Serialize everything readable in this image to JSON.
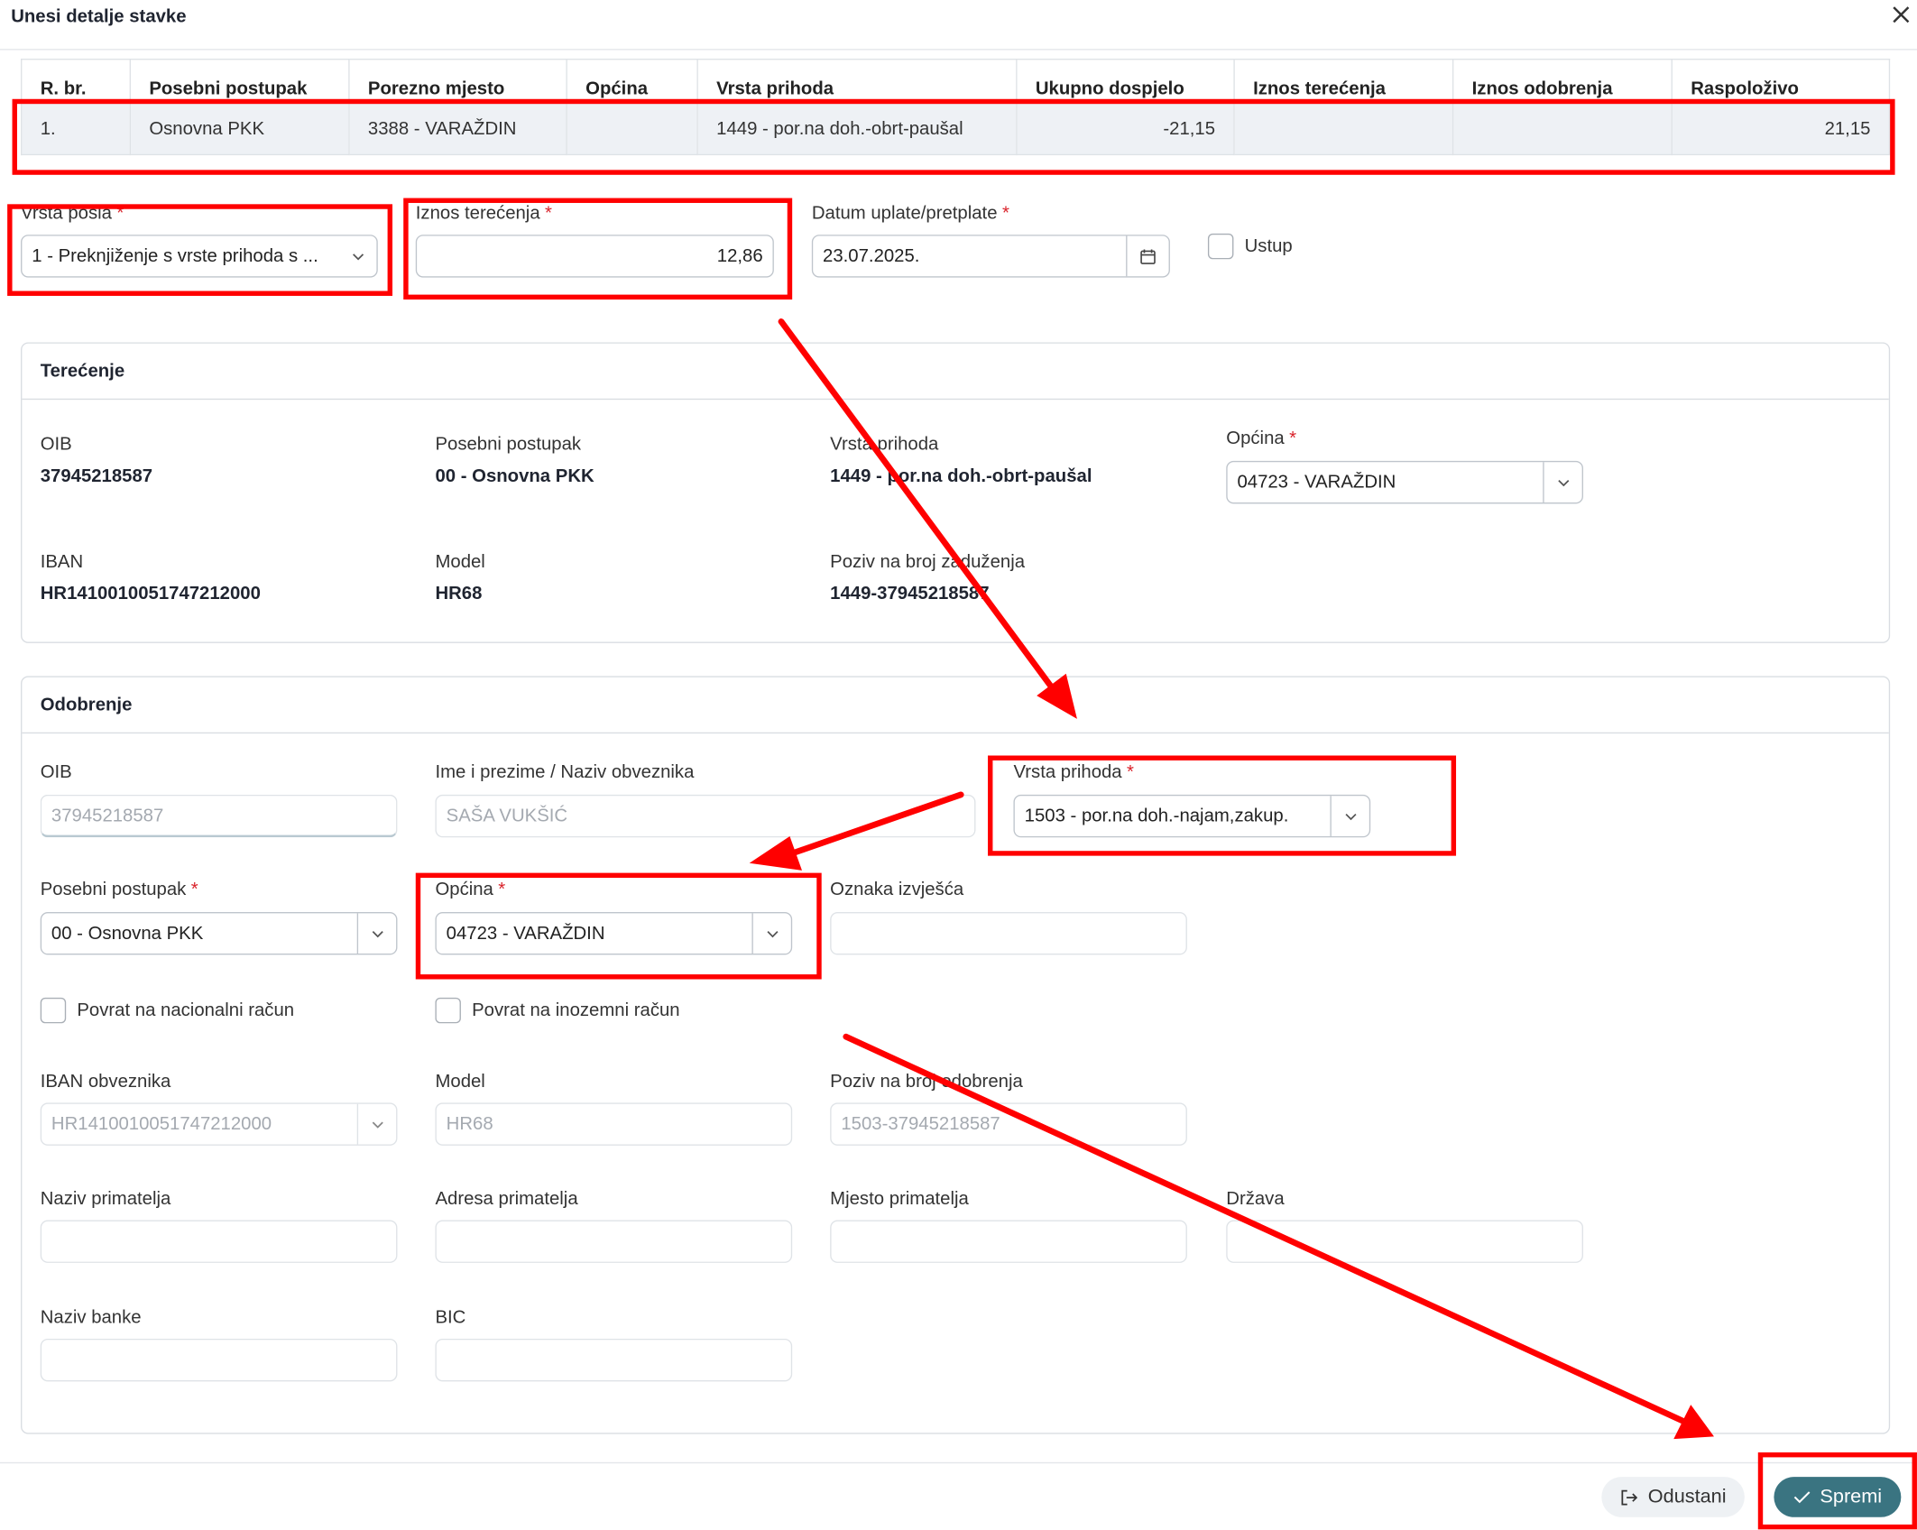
{
  "dialog": {
    "title": "Unesi detalje stavke"
  },
  "table": {
    "headers": [
      "R. br.",
      "Posebni postupak",
      "Porezno mjesto",
      "Općina",
      "Vrsta prihoda",
      "Ukupno dospjelo",
      "Iznos terećenja",
      "Iznos odobrenja",
      "Raspoloživo"
    ],
    "rows": [
      [
        "1.",
        "Osnovna PKK",
        "3388 - VARAŽDIN",
        "",
        "1449 - por.na doh.-obrt-paušal",
        "-21,15",
        "",
        "",
        "21,15"
      ]
    ]
  },
  "form": {
    "vrsta_posla": {
      "label": "Vrsta posla",
      "value": "1 - Preknjiženje s vrste prihoda s ..."
    },
    "iznos_terecenja": {
      "label": "Iznos terećenja",
      "value": "12,86"
    },
    "datum_uplate": {
      "label": "Datum uplate/pretplate",
      "value": "23.07.2025."
    },
    "ustup": {
      "label": "Ustup"
    },
    "required_mark": "*"
  },
  "terecenje": {
    "title": "Terećenje",
    "oib": {
      "label": "OIB",
      "value": "37945218587"
    },
    "posebni_postupak": {
      "label": "Posebni postupak",
      "value": "00 - Osnovna PKK"
    },
    "vrsta_prihoda": {
      "label": "Vrsta prihoda",
      "value": "1449 - por.na doh.-obrt-paušal"
    },
    "opcina": {
      "label": "Općina",
      "value": "04723 - VARAŽDIN"
    },
    "iban": {
      "label": "IBAN",
      "value": "HR1410010051747212000"
    },
    "model": {
      "label": "Model",
      "value": "HR68"
    },
    "poziv": {
      "label": "Poziv na broj zaduženja",
      "value": "1449-37945218587"
    }
  },
  "odobrenje": {
    "title": "Odobrenje",
    "oib": {
      "label": "OIB",
      "value": "37945218587"
    },
    "ime": {
      "label": "Ime i prezime / Naziv obveznika",
      "value": "SAŠA VUKŠIĆ"
    },
    "vrsta_prihoda": {
      "label": "Vrsta prihoda",
      "value": "1503 - por.na doh.-najam,zakup."
    },
    "posebni_postupak": {
      "label": "Posebni postupak",
      "value": "00 - Osnovna PKK"
    },
    "opcina": {
      "label": "Općina",
      "value": "04723 - VARAŽDIN"
    },
    "oznaka_izvjesca": {
      "label": "Oznaka izvješća",
      "value": ""
    },
    "povrat_nacionalni": {
      "label": "Povrat na nacionalni račun"
    },
    "povrat_inozemni": {
      "label": "Povrat na inozemni račun"
    },
    "iban": {
      "label": "IBAN obveznika",
      "value": "HR1410010051747212000"
    },
    "model": {
      "label": "Model",
      "value": "HR68"
    },
    "poziv": {
      "label": "Poziv na broj odobrenja",
      "value": "1503-37945218587"
    },
    "naziv_primatelja": {
      "label": "Naziv primatelja",
      "value": ""
    },
    "adresa_primatelja": {
      "label": "Adresa primatelja",
      "value": ""
    },
    "mjesto_primatelja": {
      "label": "Mjesto primatelja",
      "value": ""
    },
    "drzava": {
      "label": "Država",
      "value": ""
    },
    "naziv_banke": {
      "label": "Naziv banke",
      "value": ""
    },
    "bic": {
      "label": "BIC",
      "value": ""
    }
  },
  "footer": {
    "cancel_label": "Odustani",
    "save_label": "Spremi"
  },
  "colors": {
    "annotation": "#ff0000",
    "primary": "#3a7481",
    "required": "#d9222a"
  },
  "icons": [
    "close-icon",
    "chevron-down-icon",
    "calendar-icon",
    "logout-icon",
    "check-icon"
  ]
}
